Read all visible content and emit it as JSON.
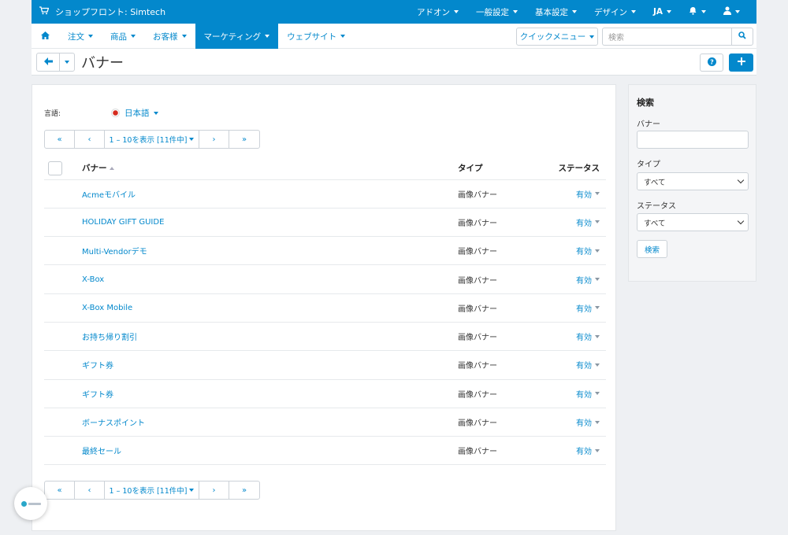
{
  "topbar": {
    "store": "ショップフロント: Simtech",
    "menu": [
      "アドオン",
      "一般設定",
      "基本設定",
      "デザイン",
      "JA"
    ]
  },
  "nav": {
    "tabs": [
      "注文",
      "商品",
      "お客様",
      "マーケティング",
      "ウェブサイト"
    ],
    "active_tab": "マーケティング",
    "quick_menu": "クイックメニュー",
    "search_placeholder": "検索"
  },
  "page": {
    "title": "バナー"
  },
  "filters": {
    "language_label": "言語:",
    "language_value": "日本語"
  },
  "pagination": {
    "first": "«",
    "prev": "‹",
    "info": "1 – 10を表示 [11件中]",
    "next": "›",
    "last": "»"
  },
  "table": {
    "headers": {
      "name": "バナー",
      "type": "タイプ",
      "status": "ステータス"
    },
    "rows": [
      {
        "name": "Acmeモバイル",
        "type": "画像バナー",
        "status": "有効"
      },
      {
        "name": "HOLIDAY GIFT GUIDE",
        "type": "画像バナー",
        "status": "有効"
      },
      {
        "name": "Multi-Vendorデモ",
        "type": "画像バナー",
        "status": "有効"
      },
      {
        "name": "X-Box",
        "type": "画像バナー",
        "status": "有効"
      },
      {
        "name": "X-Box Mobile",
        "type": "画像バナー",
        "status": "有効"
      },
      {
        "name": "お持ち帰り割引",
        "type": "画像バナー",
        "status": "有効"
      },
      {
        "name": "ギフト券",
        "type": "画像バナー",
        "status": "有効"
      },
      {
        "name": "ギフト券",
        "type": "画像バナー",
        "status": "有効"
      },
      {
        "name": "ボーナスポイント",
        "type": "画像バナー",
        "status": "有効"
      },
      {
        "name": "最終セール",
        "type": "画像バナー",
        "status": "有効"
      }
    ]
  },
  "sidebar": {
    "title": "検索",
    "banner_label": "バナー",
    "type_label": "タイプ",
    "type_value": "すべて",
    "status_label": "ステータス",
    "status_value": "すべて",
    "search_button": "検索"
  },
  "colors": {
    "primary": "#0388cc",
    "background": "#eef0f3"
  }
}
